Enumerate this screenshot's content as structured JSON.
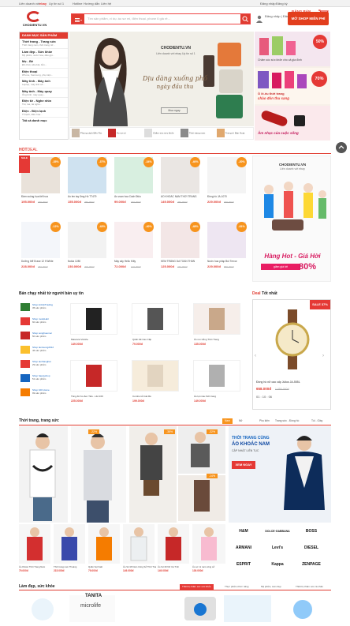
{
  "topbar": {
    "partner": "Liên doanh với",
    "partner_brand": "ebay",
    "partner_tail": "Uy tín số 1",
    "hotline": "Hotline",
    "guide": "Hướng dẫn",
    "contact": "Liên hệ",
    "login": "Đăng nhập",
    "signup_separator": "|",
    "register": "Đăng ký",
    "signup_label": "ĐĂNG BÁN"
  },
  "header": {
    "logo_text": "CHODIENTU.VN",
    "search_placeholder": "Tìm sản phẩm, ví dụ: áo sơ mi, điện thoại, phone 6 giá rẻ...",
    "open_shop": "MỞ SHOP MIỄN PHÍ",
    "cart_count": "0"
  },
  "sidebar": {
    "title": "DANH MỤC SẢN PHẨM",
    "items": [
      {
        "label": "Thời trang - Trang sức",
        "sub": "Thời trang nam, thời trang nữ..."
      },
      {
        "label": "Làm đẹp - Sức khỏe",
        "sub": "Mỹ phẩm, nước hoa, dầu gội..."
      },
      {
        "label": "Mẹ - Bé",
        "sub": "Đồ chơi, sữa bột, bỉm..."
      },
      {
        "label": "Điện thoại",
        "sub": "iPhone, Samsung, phụ kiện..."
      },
      {
        "label": "Máy tính - Máy ảnh",
        "sub": "Laptop, máy ảnh số..."
      },
      {
        "label": "Máy ảnh - Máy quay",
        "sub": "Ống kính, máy quay..."
      },
      {
        "label": "Điện tử - Nghe nhìn",
        "sub": "Tivi, loa, tai nghe..."
      },
      {
        "label": "Điện - Điện lạnh",
        "sub": "Tủ lạnh, điều hòa..."
      },
      {
        "label": "Tất cả danh mục",
        "sub": ""
      }
    ]
  },
  "banner": {
    "brand": "CHODIENTU.VN",
    "tagline": "Liên doanh với ebay Uy tín số 1",
    "headline": "Dịu dàng xuống phố",
    "headline2": "ngày đầu thu",
    "cta": "Mua ngay"
  },
  "promo": {
    "top_badge": "50%",
    "top_caption": "Chăm sóc sức khỏe cho cả gia đình",
    "mid_title": "Ồ lê-ếu thời trang",
    "mid_caption": "chào đón thu sang",
    "mid_badge": "70%",
    "bottom_caption": "Âm nhạc của cuộc sống"
  },
  "thumbs": [
    {
      "label": "Phong cách Bến Ấm"
    },
    {
      "label": "Áo sơ mi"
    },
    {
      "label": "Chăm sóc sức khỏe"
    },
    {
      "label": "Thời trang nam"
    },
    {
      "label": "Trang trí Bàn Hoạt"
    }
  ],
  "hotdeal": {
    "title_hot": "HOT",
    "title_deal": "DEAL",
    "products": [
      {
        "name": "Đầm suông họa tiết hoa",
        "price": "195.000đ",
        "old": "299.000đ",
        "badge": "-35%",
        "color": "#e9e2da"
      },
      {
        "name": "Áo len tay lửng Hồ TT479",
        "price": "155.000đ",
        "old": "250.000đ",
        "badge": "-37%",
        "color": "#cfe2f0"
      },
      {
        "name": "Áo voan hoa Cách Điệu",
        "price": "99.000đ",
        "old": "150.000đ",
        "badge": "-34%",
        "color": "#d8efe0"
      },
      {
        "name": "ÁO KHOÁC NAM THỜI TRANG",
        "price": "149.000đ",
        "old": "250.000đ",
        "badge": "-40%",
        "color": "#eae6e3"
      },
      {
        "name": "Đồng hồ JA-1070",
        "price": "229.000đ",
        "old": "300.000đ",
        "badge": "-20%",
        "color": "#f4f4f4"
      },
      {
        "name": "Dưỡng thể Erase 12 fl White",
        "price": "228.000đ",
        "old": "260.000đ",
        "badge": "-12%",
        "color": "#f4f6fa"
      },
      {
        "name": "Nokia 1280",
        "price": "230.000đ",
        "old": "400.000đ",
        "badge": "-43%",
        "color": "#f2f2f2"
      },
      {
        "name": "Máy sấy Hello Kitty",
        "price": "72.000đ",
        "old": "120.000đ",
        "badge": "-40%",
        "color": "#f9eef0"
      },
      {
        "name": "KEM TRẮNG DA TOÀN THÂN",
        "price": "125.000đ",
        "old": "240.000đ",
        "badge": "-48%",
        "color": "#f3e6e6"
      },
      {
        "name": "Nước hoa pháp Bùi Trevor",
        "price": "229.000đ",
        "old": "589.000đ",
        "badge": "-61%",
        "color": "#eee6f2"
      }
    ],
    "side_brand": "CHODIENTU.VN",
    "side_tagline": "Liên doanh với ebay",
    "side_title": "Hàng Hot - Giá Hời",
    "side_sub": "giảm giá tới",
    "side_pct": "80%"
  },
  "bestsell": {
    "title": "Bán chạy nhất từ người bán uy tín",
    "shops": [
      {
        "name": "Shop AnhHiTrading",
        "count": "35 sản phẩm",
        "color": "#2e7d32"
      },
      {
        "name": "Shop modoHair",
        "count": "60 sản phẩm",
        "color": "#e53935"
      },
      {
        "name": "Shop songhuemoc",
        "count": "50 sản phẩm",
        "color": "#c62828"
      },
      {
        "name": "Shop tamtuong2012",
        "count": "46 sản phẩm",
        "color": "#fbc02d"
      },
      {
        "name": "Shop tanthanghai",
        "count": "29 sản phẩm",
        "color": "#e53935"
      },
      {
        "name": "Shop happyshop",
        "count": "51 sản phẩm",
        "color": "#1565c0"
      },
      {
        "name": "Shop 100 Home",
        "count": "99 sản phẩm",
        "color": "#f57c00"
      }
    ],
    "items": [
      {
        "name": "Mascara Vivishe",
        "price": "149.000đ",
        "color": "#ffffff"
      },
      {
        "name": "Quần tất Cao Cấp",
        "price": "79.000đ",
        "color": "#ffffff"
      },
      {
        "name": "Áo ren trắng Thời Trang",
        "price": "135.000đ",
        "color": "#f6eeea"
      },
      {
        "name": "Tông đơ bo đen Tiểu - HH 169",
        "price": "225.000đ",
        "color": "#ffffff"
      },
      {
        "name": "Combo tủi Giá Rẻ",
        "price": "199.000đ",
        "color": "#f6ecdb"
      },
      {
        "name": "Áo lọt màu thời trang",
        "price": "149.000đ",
        "color": "#ffffff"
      }
    ],
    "deal_title_red": "Deal",
    "deal_title": "Tốt nhất",
    "deal_badge": "SALE 37%",
    "deal_name": "Đồng hồ nữ cao cấp Julius JA-555L",
    "deal_price": "658.000đ",
    "deal_old": "1.050.000đ",
    "deal_countdown": "01 : 10 : 06"
  },
  "fashion": {
    "title": "Thời trang, trang sức",
    "tabs": [
      "Nam",
      "Nữ",
      "Phụ kiện",
      "Trang sức - Đồng hồ",
      "Túi - Giày"
    ],
    "banner_title": "THỜI TRANG CÙNG",
    "banner_title2": "ÁO KHOÁC NAM",
    "banner_sub": "CẬP NHẬT LIÊN TỤC",
    "banner_cta": "XEM NGAY",
    "items": [
      {
        "name": "Áo Khoác Thời Trang Nam",
        "price": "79.000đ",
        "old": "120.000đ",
        "badge": "-22%"
      },
      {
        "name": "Thời trang nam Thoáng",
        "price": "215.000đ",
        "old": "",
        "badge": "-35%"
      },
      {
        "name": "Quần Sọt Kaki",
        "price": "79.000đ",
        "old": "",
        "badge": "-32%"
      },
      {
        "name": "Áo Sơ Mi Nam Công Sở Thời Trang",
        "price": "149.000đ",
        "old": "",
        "badge": "-14%"
      },
      {
        "name": "Áo Sơ Mi Nữ Cá Tính",
        "price": "149.000đ",
        "old": "",
        "badge": ""
      },
      {
        "name": "Áo sơ mi nam công sở",
        "price": "139.000đ",
        "old": "",
        "badge": "-40%"
      }
    ],
    "brands": [
      "H&M",
      "DOLCE·GABBANA",
      "BOSS",
      "ARMANI",
      "Levi's",
      "DIESEL",
      "ESPRIT",
      "Kappa",
      "ZENPAGE"
    ]
  },
  "beauty": {
    "title": "Làm đẹp, sức khỏe",
    "tabs": [
      "Thiết bị chăm sóc sức khỏe",
      "Thực phẩm chức năng",
      "Mỹ phẩm, Làm đẹp",
      "Thiết bị chăm sóc cá nhân"
    ],
    "brand1": "TANITA",
    "brand2": "microlife"
  }
}
